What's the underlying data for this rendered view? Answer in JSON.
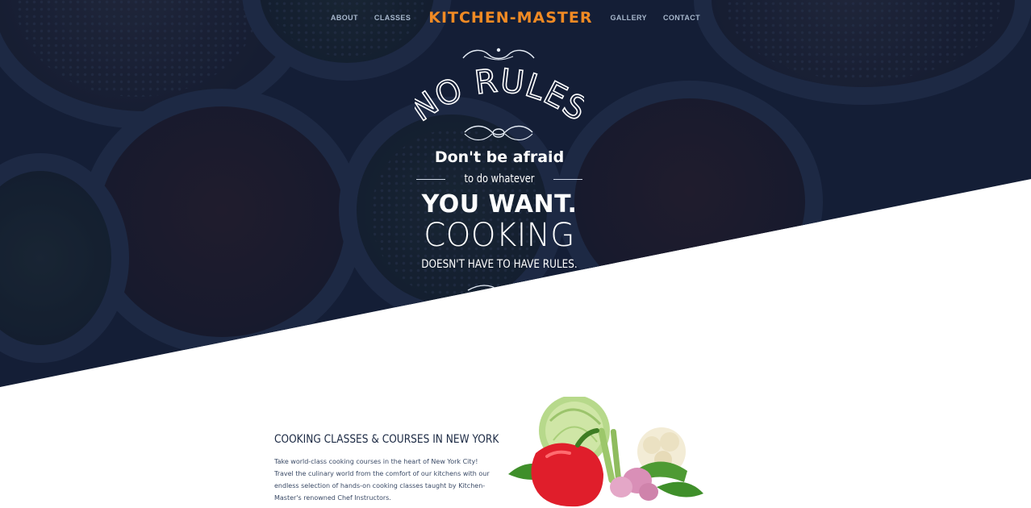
{
  "nav": {
    "items": [
      "ABOUT",
      "CLASSES",
      "GALLERY",
      "CONTACT"
    ],
    "logo": "KITCHEN-MASTER"
  },
  "hero": {
    "headline_script": "NO RULES",
    "line1": "Don't be afraid",
    "line2": "to do whatever",
    "line3": "YOU WANT.",
    "line4": "COOKING",
    "line5": "DOESN'T HAVE TO HAVE RULES."
  },
  "about": {
    "title": "COOKING CLASSES & COURSES IN NEW YORK",
    "body": "Take world-class cooking courses in the heart of New York City! Travel the culinary world from the comfort of our kitchens with our endless selection of hands-on cooking classes taught by Kitchen-Master's renowned Chef Instructors."
  },
  "colors": {
    "hero_bg": "#17223a",
    "logo": "#f08a24",
    "text_dark": "#1c2a44"
  },
  "icons": [
    "ornament-top-icon",
    "ornament-bottom-icon",
    "vegetables-image"
  ]
}
